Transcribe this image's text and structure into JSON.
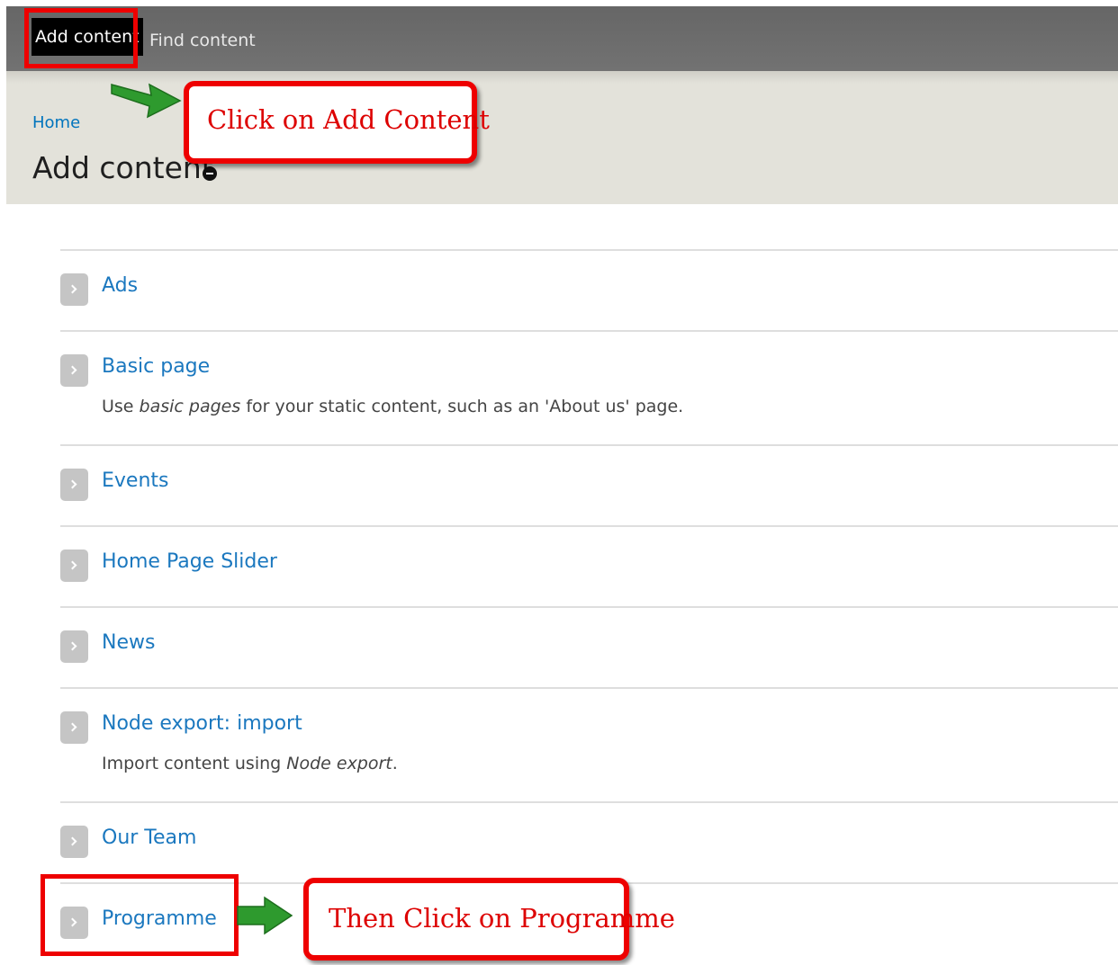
{
  "toolbar": {
    "add_content": "Add content",
    "find_content": "Find content"
  },
  "header": {
    "breadcrumb": "Home",
    "title": "Add content"
  },
  "content_types": [
    {
      "label": "Ads",
      "description": ""
    },
    {
      "label": "Basic page",
      "description_pre": "Use ",
      "description_em": "basic pages",
      "description_post": " for your static content, such as an 'About us' page."
    },
    {
      "label": "Events",
      "description": ""
    },
    {
      "label": "Home Page Slider",
      "description": ""
    },
    {
      "label": "News",
      "description": ""
    },
    {
      "label": "Node export: import",
      "description_pre": "Import content using ",
      "description_em": "Node export",
      "description_post": "."
    },
    {
      "label": "Our Team",
      "description": ""
    },
    {
      "label": "Programme",
      "description": ""
    }
  ],
  "annotations": {
    "step1": "Click on Add Content",
    "step2": "Then Click on Programme"
  },
  "colors": {
    "link": "#1b78bf",
    "annotation_red": "#ee0000",
    "arrow_green": "#2e9a2e"
  }
}
